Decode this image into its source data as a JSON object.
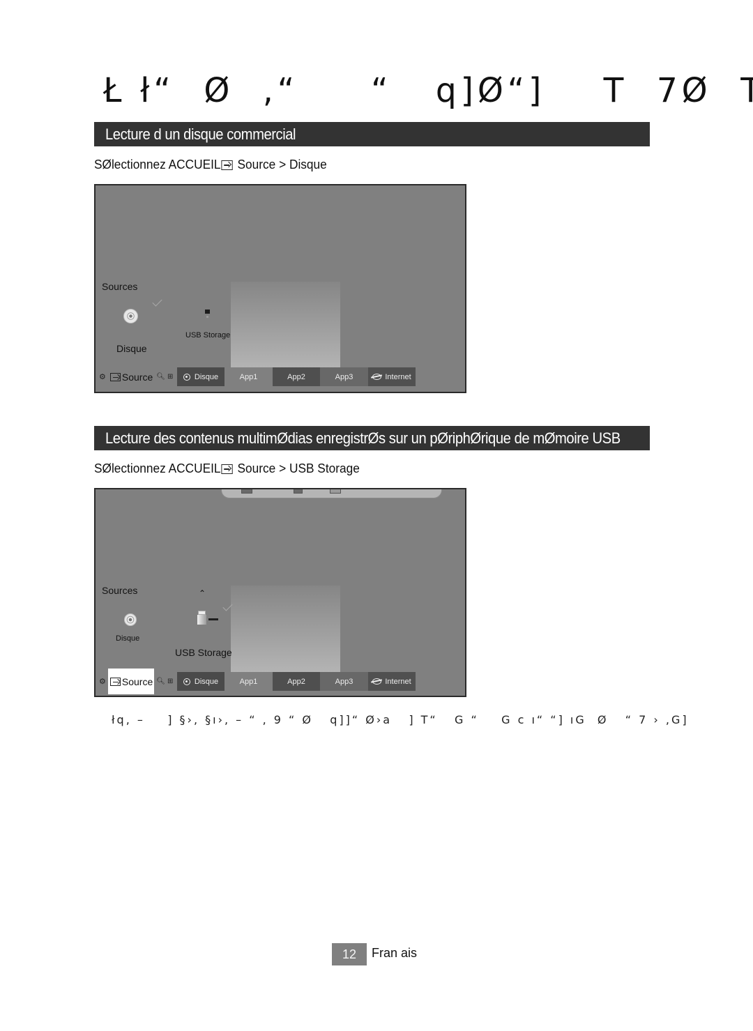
{
  "page": {
    "title": "Ł ł“  Ø  ,“     “   q]Ø“]    T  7Ø  T›",
    "footnote": "łq, –    ] §›, §ı›, – “ , 9 “ Ø   q]]“ Ø›a   ] T“   G “    G c ı“ “] ıG  Ø   “ 7 › ,G]",
    "page_number": "12",
    "language": "Fran ais"
  },
  "sections": [
    {
      "heading": "Lecture d un disque commercial",
      "instruction_prefix": "SØlectionnez ACCUEIL",
      "instruction_suffix": " Source > Disque",
      "screen": {
        "sources_label": "Sources",
        "items": [
          {
            "label": "Disque",
            "icon": "disc-icon",
            "selected": true
          },
          {
            "label": "USB Storage",
            "icon": "usb-icon",
            "selected": false
          }
        ],
        "taskbar": {
          "source_label": "Source",
          "source_selected": false,
          "tiles": [
            {
              "label": "Disque",
              "icon": "disc-circle-icon",
              "color": "#4a4a4a"
            },
            {
              "label": "App1",
              "icon": "",
              "color": "#808080"
            },
            {
              "label": "App2",
              "icon": "",
              "color": "#4f4f4f"
            },
            {
              "label": "App3",
              "icon": "",
              "color": "#686868"
            },
            {
              "label": "Internet",
              "icon": "globe-icon",
              "color": "#505050"
            }
          ]
        }
      }
    },
    {
      "heading": "Lecture des contenus multimØdias enregistrØs sur un pØriphØrique de mØmoire USB",
      "instruction_prefix": "SØlectionnez ACCUEIL",
      "instruction_suffix": " Source > USB Storage",
      "screen": {
        "sources_label": "Sources",
        "items": [
          {
            "label": "Disque",
            "icon": "disc-icon",
            "selected": false
          },
          {
            "label": "USB Storage",
            "icon": "usb-icon",
            "selected": true
          }
        ],
        "taskbar": {
          "source_label": "Source",
          "source_selected": true,
          "tiles": [
            {
              "label": "Disque",
              "icon": "disc-circle-icon",
              "color": "#4a4a4a"
            },
            {
              "label": "App1",
              "icon": "",
              "color": "#808080"
            },
            {
              "label": "App2",
              "icon": "",
              "color": "#4f4f4f"
            },
            {
              "label": "App3",
              "icon": "",
              "color": "#686868"
            },
            {
              "label": "Internet",
              "icon": "globe-icon",
              "color": "#505050"
            }
          ]
        }
      }
    }
  ]
}
